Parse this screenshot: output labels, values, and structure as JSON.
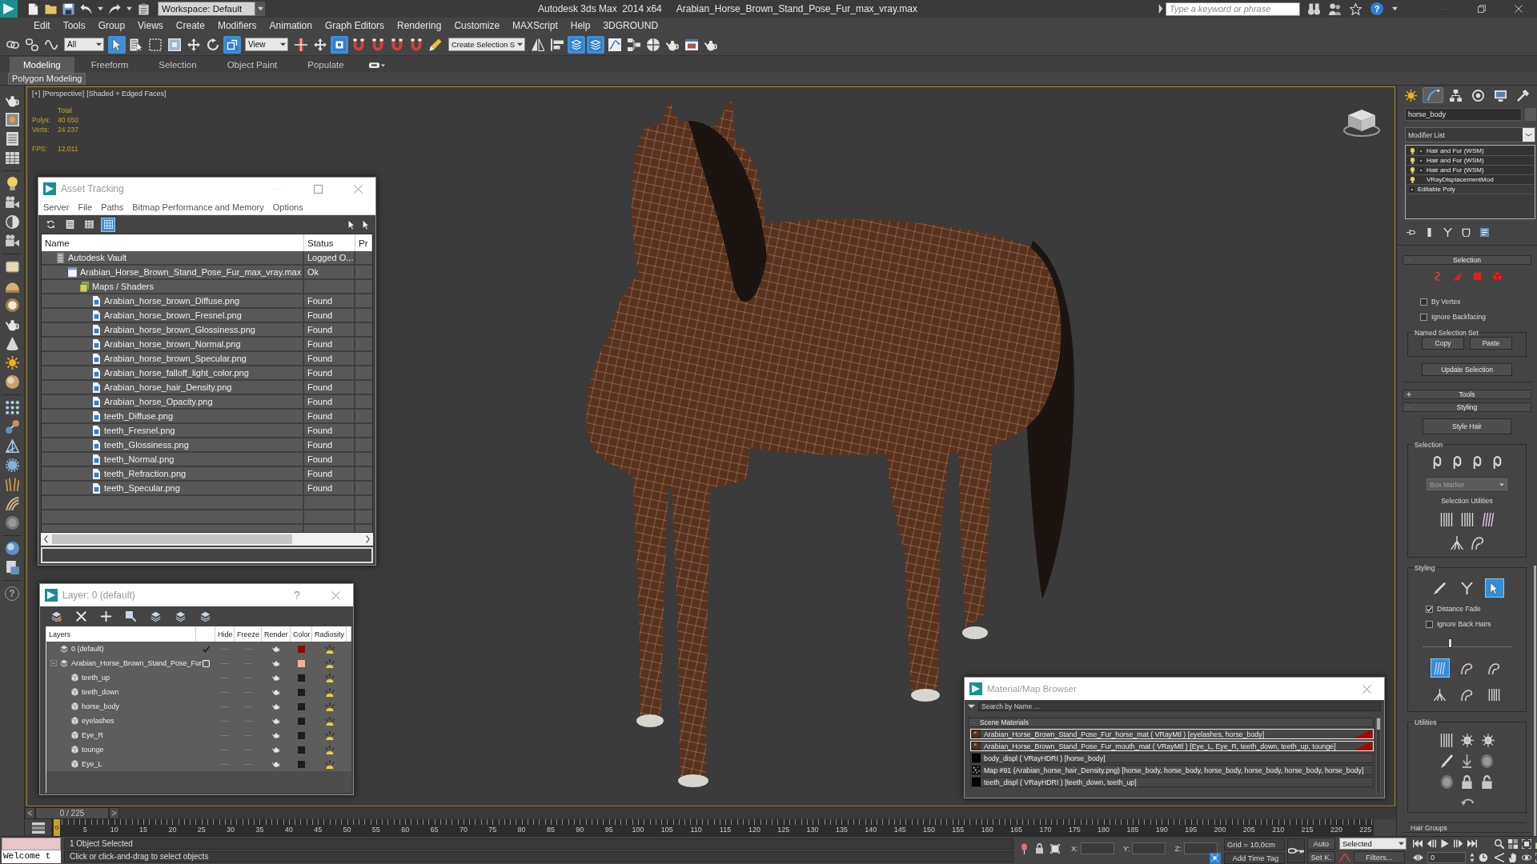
{
  "title_bar": {
    "workspace": "Workspace: Default",
    "app_title": "Autodesk 3ds Max  2014 x64",
    "file_title": "Arabian_Horse_Brown_Stand_Pose_Fur_max_vray.max",
    "search": {
      "placeholder": "Type a keyword or phrase"
    },
    "help": "?"
  },
  "menu_bar": [
    "Edit",
    "Tools",
    "Group",
    "Views",
    "Create",
    "Modifiers",
    "Animation",
    "Graph Editors",
    "Rendering",
    "Customize",
    "MAXScript",
    "Help",
    "3DGROUND"
  ],
  "main_toolbar": {
    "selection_filter": "All",
    "coordinate_system": "View",
    "named_selection_set": "Create Selection S",
    "tools": [
      {
        "selected": false
      },
      {
        "selected": false
      },
      {
        "selected": false
      },
      {
        "selected": true
      },
      {
        "selected": false
      },
      {
        "selected": false
      },
      {
        "selected": false
      },
      {
        "selected": false
      },
      {
        "selected": false
      },
      {
        "selected": true
      },
      {
        "selected": false
      },
      {
        "selected": false
      },
      {
        "selected": true
      },
      {
        "selected": false
      },
      {
        "selected": false
      },
      {
        "selected": false
      },
      {
        "selected": false
      },
      {
        "selected": false
      },
      {
        "selected": false
      },
      {
        "selected": false
      },
      {
        "selected": true
      },
      {
        "selected": true
      },
      {
        "selected": false
      },
      {
        "selected": false
      },
      {
        "selected": false
      },
      {
        "selected": false
      },
      {
        "selected": false
      },
      {
        "selected": false
      }
    ]
  },
  "ribbon": {
    "tabs": [
      {
        "label": "Modeling",
        "selected": true
      },
      {
        "label": "Freeform",
        "selected": false
      },
      {
        "label": "Selection",
        "selected": false
      },
      {
        "label": "Object Paint",
        "selected": false
      },
      {
        "label": "Populate",
        "selected": false
      }
    ],
    "panel_button": "Polygon Modeling"
  },
  "command_toolbar": {
    "help": "?"
  },
  "viewport": {
    "menus": [
      "[+]",
      "[Perspective]",
      "[Shaded + Edged Faces]"
    ],
    "statistics": {
      "heading": "Total",
      "rows": [
        {
          "label": "Polys:",
          "value": "40 650"
        },
        {
          "label": "Verts:",
          "value": "24 237"
        }
      ],
      "fps": {
        "label": "FPS:",
        "value": "12,011"
      }
    }
  },
  "asset_tracking": {
    "title": "Asset Tracking",
    "menus": [
      "Server",
      "File",
      "Paths",
      "Bitmap Performance and Memory",
      "Options"
    ],
    "view_buttons": [
      {
        "selected": false
      },
      {
        "selected": false
      },
      {
        "selected": false
      },
      {
        "selected": true
      }
    ],
    "columns": [
      "Name",
      "Status",
      "Pr"
    ],
    "rows": [
      {
        "kind": "vault",
        "name": "Autodesk Vault",
        "status": "Logged O...",
        "children": [
          {
            "kind": "scene",
            "name": "Arabian_Horse_Brown_Stand_Pose_Fur_max_vray.max",
            "status": "Ok",
            "children": [
              {
                "kind": "folder",
                "name": "Maps / Shaders",
                "children": [
                  {
                    "kind": "map",
                    "name": "Arabian_horse_brown_Diffuse.png",
                    "status": "Found"
                  },
                  {
                    "kind": "map",
                    "name": "Arabian_horse_brown_Fresnel.png",
                    "status": "Found"
                  },
                  {
                    "kind": "map",
                    "name": "Arabian_horse_brown_Glossiness.png",
                    "status": "Found"
                  },
                  {
                    "kind": "map",
                    "name": "Arabian_horse_brown_Normal.png",
                    "status": "Found"
                  },
                  {
                    "kind": "map",
                    "name": "Arabian_horse_brown_Specular.png",
                    "status": "Found"
                  },
                  {
                    "kind": "map",
                    "name": "Arabian_horse_falloff_light_color.png",
                    "status": "Found"
                  },
                  {
                    "kind": "map",
                    "name": "Arabian_horse_hair_Density.png",
                    "status": "Found"
                  },
                  {
                    "kind": "map",
                    "name": "Arabian_horse_Opacity.png",
                    "status": "Found"
                  },
                  {
                    "kind": "map",
                    "name": "teeth_Diffuse.png",
                    "status": "Found"
                  },
                  {
                    "kind": "map",
                    "name": "teeth_Fresnel.png",
                    "status": "Found"
                  },
                  {
                    "kind": "map",
                    "name": "teeth_Glossiness.png",
                    "status": "Found"
                  },
                  {
                    "kind": "map",
                    "name": "teeth_Normal.png",
                    "status": "Found"
                  },
                  {
                    "kind": "map",
                    "name": "teeth_Refraction.png",
                    "status": "Found"
                  },
                  {
                    "kind": "map",
                    "name": "teeth_Specular.png",
                    "status": "Found"
                  }
                ]
              }
            ]
          }
        ]
      }
    ]
  },
  "layer_manager": {
    "title": "Layer: 0 (default)",
    "help": "?",
    "columns": [
      "Layers",
      "Hide",
      "Freeze",
      "Render",
      "Color",
      "Radiosity"
    ],
    "layers": [
      {
        "name": "0 (default)",
        "current": true,
        "hide": false,
        "freeze": false,
        "render": true,
        "color": "#8b0a0a",
        "radiosity": true
      },
      {
        "name": "Arabian_Horse_Brown_Stand_Pose_Fur",
        "current": false,
        "expanded": true,
        "hide": false,
        "freeze": false,
        "render": true,
        "color": "#eab596",
        "radiosity": true,
        "children": [
          {
            "name": "teeth_up",
            "hide": false,
            "freeze": false,
            "render": true,
            "color": "#1c1c1c",
            "radiosity": true
          },
          {
            "name": "teeth_down",
            "hide": false,
            "freeze": false,
            "render": true,
            "color": "#1c1c1c",
            "radiosity": true
          },
          {
            "name": "horse_body",
            "hide": false,
            "freeze": false,
            "render": true,
            "color": "#1c1c1c",
            "radiosity": true
          },
          {
            "name": "eyelashes",
            "hide": false,
            "freeze": false,
            "render": true,
            "color": "#1c1c1c",
            "radiosity": true
          },
          {
            "name": "Eye_R",
            "hide": false,
            "freeze": false,
            "render": true,
            "color": "#1c1c1c",
            "radiosity": true
          },
          {
            "name": "tounge",
            "hide": false,
            "freeze": false,
            "render": true,
            "color": "#1c1c1c",
            "radiosity": true
          },
          {
            "name": "Eye_L",
            "hide": false,
            "freeze": false,
            "render": true,
            "color": "#1c1c1c",
            "radiosity": true
          }
        ]
      }
    ]
  },
  "material_browser": {
    "title": "Material/Map Browser",
    "search": {
      "placeholder": "Search by Name ..."
    },
    "group": {
      "title": "Scene Materials",
      "expanded": true,
      "items": [
        {
          "kind": "material",
          "label": "Arabian_Horse_Brown_Stand_Pose_Fur_horse_mat ( VRayMtl ) [eyelashes, horse_body]",
          "hot": true
        },
        {
          "kind": "material",
          "label": "Arabian_Horse_Brown_Stand_Pose_Fur_mouth_mat ( VRayMtl ) [Eye_L, Eye_R, teeth_down, teeth_up, tounge]",
          "hot": true
        },
        {
          "kind": "map",
          "label": "body_displ ( VRayHDRI ) [horse_body]",
          "hot": false
        },
        {
          "kind": "bitmap",
          "label": "Map #91 (Arabian_horse_hair_Density.png) [horse_body, horse_body, horse_body, horse_body, horse_body, horse_body]",
          "hot": false
        },
        {
          "kind": "map",
          "label": "teeth_displ ( VRayHDRI ) [teeth_down, teeth_up]",
          "hot": false
        }
      ]
    }
  },
  "command_panel": {
    "tabs": [
      {
        "selected": false
      },
      {
        "selected": true
      },
      {
        "selected": false
      },
      {
        "selected": false
      },
      {
        "selected": false
      },
      {
        "selected": false
      }
    ],
    "object_name": "horse_body",
    "modifier_list": "Modifier List",
    "stack": [
      {
        "kind": "modifier",
        "name": "Hair and Fur (WSM)",
        "on": true,
        "expanded": false
      },
      {
        "kind": "modifier",
        "name": "Hair and Fur (WSM)",
        "on": true,
        "expanded": false
      },
      {
        "kind": "modifier",
        "name": "Hair and Fur (WSM)",
        "on": true,
        "expanded": false
      },
      {
        "kind": "modifier",
        "name": "VRayDisplacementMod",
        "on": true
      },
      {
        "kind": "base",
        "name": "Editable Poly",
        "expanded": false
      }
    ],
    "rollouts": [
      {
        "kind": "selection",
        "title": "Selection",
        "expanded": true,
        "checkboxes": [
          {
            "label": "By Vertex",
            "checked": false
          },
          {
            "label": "Ignore Backfacing",
            "checked": false
          }
        ],
        "group": "Named Selection Set",
        "buttons": [
          "Copy",
          "Paste"
        ],
        "update_button": "Update Selection"
      },
      {
        "kind": "tools",
        "title": "Tools",
        "expanded": false
      },
      {
        "kind": "styling",
        "title": "Styling",
        "expanded": true,
        "style_button": "Style Hair",
        "selection_group": {
          "title": "Selection",
          "marker": {
            "value": "Box Marker",
            "disabled": true
          },
          "utilities": "Selection Utilities"
        },
        "styling_group": {
          "title": "Styling",
          "tools": [
            {
              "selected": false
            },
            {
              "selected": false
            },
            {
              "selected": true
            }
          ],
          "checkboxes": [
            {
              "label": "Distance Fade",
              "checked": true
            },
            {
              "label": "Ignore Back Hairs",
              "checked": false
            }
          ],
          "level": 0.3,
          "brushes": [
            {
              "selected": true
            },
            {
              "selected": false
            },
            {
              "selected": false
            },
            {
              "selected": false
            },
            {
              "selected": false
            },
            {
              "selected": false
            }
          ]
        },
        "utilities_group": {
          "title": "Utilities"
        },
        "hair_groups": {
          "title": "Hair Groups"
        }
      }
    ]
  },
  "time_slider": {
    "prev": "<",
    "label": "0 / 225",
    "next": ">"
  },
  "track_bar": {
    "current": "0",
    "ticks": [
      "5",
      "10",
      "15",
      "20",
      "25",
      "30",
      "35",
      "40",
      "45",
      "50",
      "55",
      "60",
      "65",
      "70",
      "75",
      "80",
      "85",
      "90",
      "95",
      "100",
      "105",
      "110",
      "115",
      "120",
      "125",
      "130",
      "135",
      "140",
      "145",
      "150",
      "155",
      "160",
      "165",
      "170",
      "175",
      "180",
      "185",
      "190",
      "195",
      "200",
      "205",
      "210",
      "215",
      "220",
      "225"
    ]
  },
  "status_bar": {
    "listener": "Welcome t",
    "selection": "1 Object Selected",
    "prompt": "Click or click-and-drag to select objects",
    "coordinates": [
      "X:",
      "Y:",
      "Z:"
    ],
    "grid": "Grid = 10,0cm",
    "time_tag": "Add Time Tag"
  },
  "animation_controls": {
    "auto_key": "Auto",
    "key_filter": "Selected",
    "set_key": "Set K.",
    "filters": "Filters...",
    "frame": "0"
  }
}
